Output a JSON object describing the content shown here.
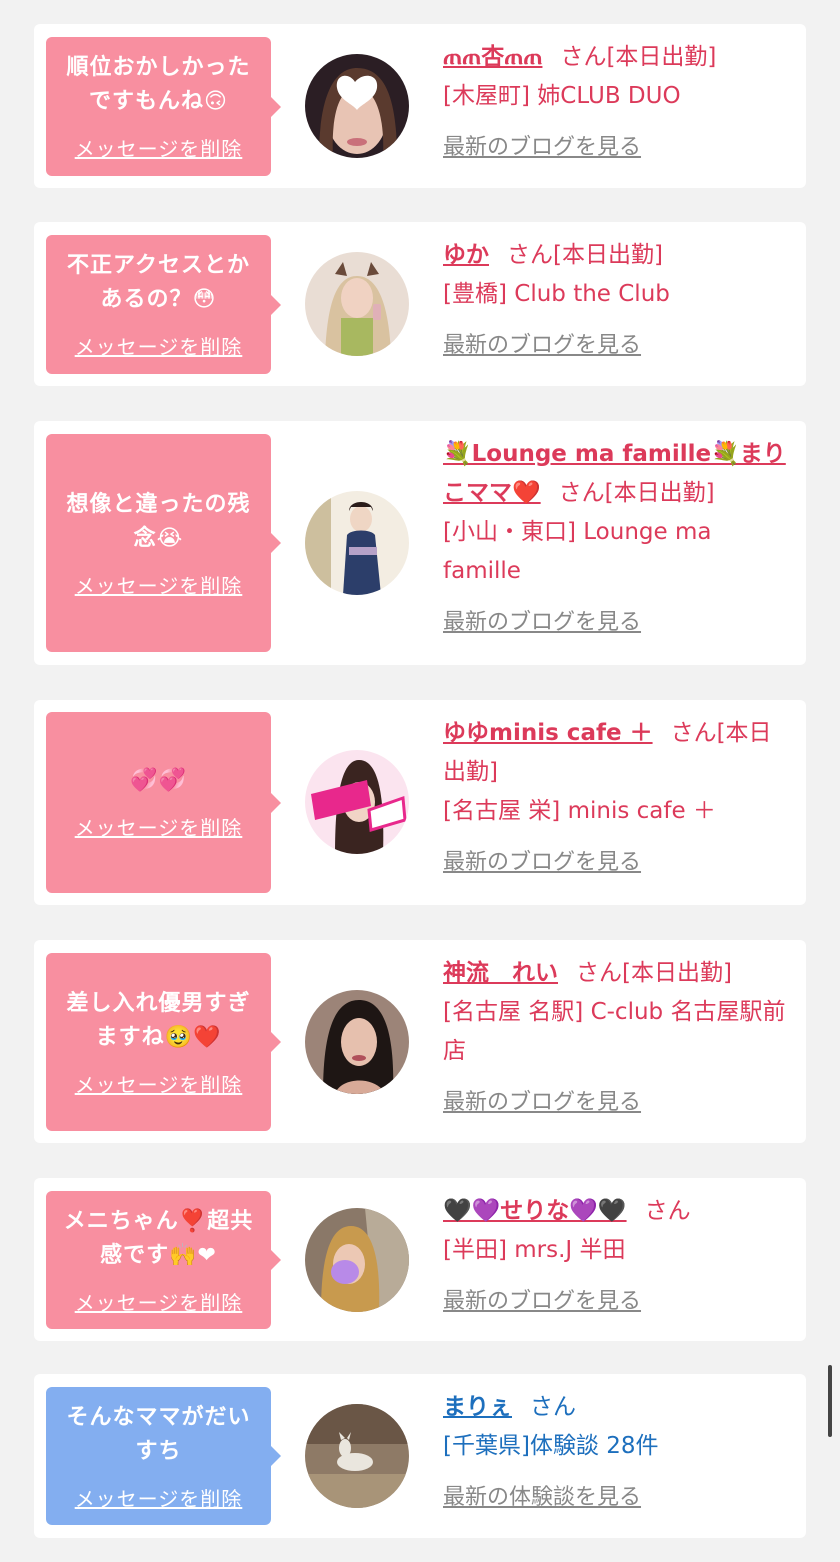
{
  "common": {
    "delete_label": "メッセージを削除",
    "blog_label": "最新のブログを見る"
  },
  "colors": {
    "page_bg": "#f2f2f2",
    "bubble_pink": "#f88fa0",
    "bubble_blue": "#83aef0",
    "text_pink": "#dc3a5a",
    "text_blue": "#1d6fbd",
    "link_gray": "#888888"
  },
  "items": [
    {
      "message_1": "順位おかしかった",
      "message_2": "ですもんね🙃",
      "name": "ጠጠ杏ጠጠ",
      "suffix": "さん[本日出勤]",
      "shop": "[木屋町] 姉CLUB DUO",
      "link": "最新のブログを見る"
    },
    {
      "message_1": "不正アクセスとか",
      "message_2": "あるの？😳",
      "name": "ゆか",
      "suffix": "さん[本日出勤]",
      "shop": "[豊橋] Club the Club",
      "link": "最新のブログを見る"
    },
    {
      "message_1": "想像と違ったの残",
      "message_2": "念😭",
      "name": "💐Lounge ma famille💐まりこママ❤️",
      "suffix": "さん[本日出勤]",
      "shop": "[小山・東口] Lounge ma famille",
      "link": "最新のブログを見る"
    },
    {
      "message_1": "💞💞",
      "message_2": "",
      "name": "ゆゆminis cafe ＋",
      "suffix": "さん[本日出勤]",
      "shop": "[名古屋 栄] minis cafe ＋",
      "link": "最新のブログを見る"
    },
    {
      "message_1": "差し入れ優男すぎ",
      "message_2": "ますね🥹❤️",
      "name": "神流　れい",
      "suffix": "さん[本日出勤]",
      "shop": "[名古屋 名駅] C-club 名古屋駅前店",
      "link": "最新のブログを見る"
    },
    {
      "message_1": "メニちゃん❣️超共",
      "message_2": "感です🙌❤",
      "name": "🖤💜せりな💜🖤",
      "suffix": "さん",
      "shop": "[半田] mrs.J 半田",
      "link": "最新のブログを見る"
    },
    {
      "message_1": "そんなママがだい",
      "message_2": "すち",
      "name": "まりぇ",
      "suffix": "さん",
      "shop": "[千葉県]体験談 28件",
      "link": "最新の体験談を見る"
    }
  ]
}
